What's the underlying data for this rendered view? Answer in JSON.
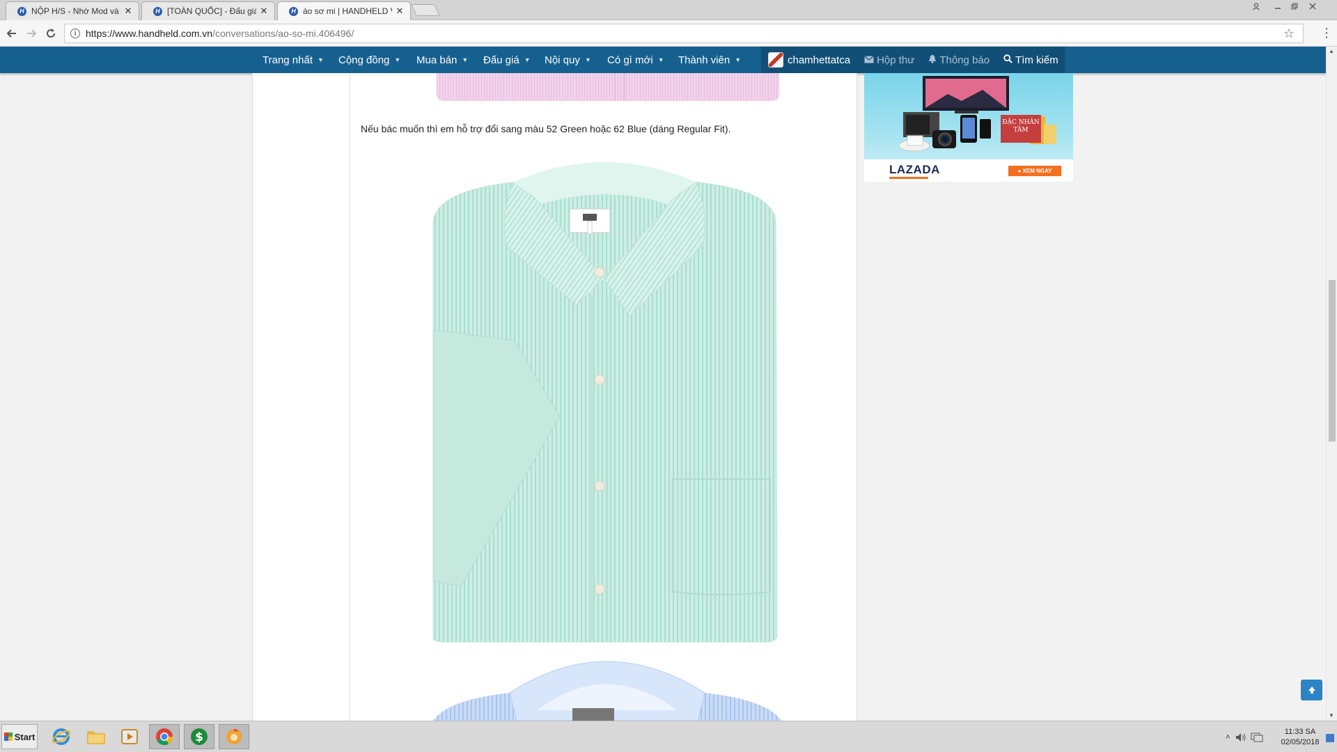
{
  "browser": {
    "tabs": [
      {
        "title": "NỘP H/S - Nhờ Mod và các",
        "active": false
      },
      {
        "title": "[TOÀN QUỐC] - Đấu giá ác",
        "active": false
      },
      {
        "title": "áo sơ mi | HANDHELD VIE",
        "active": true
      }
    ],
    "url_domain": "https://www.handheld.com.vn",
    "url_path": "/conversations/ao-so-mi.406496/"
  },
  "site_nav": {
    "items": [
      {
        "label": "Trang nhất"
      },
      {
        "label": "Cộng đồng"
      },
      {
        "label": "Mua bán"
      },
      {
        "label": "Đấu giá"
      },
      {
        "label": "Nội quy"
      },
      {
        "label": "Có gì mới"
      },
      {
        "label": "Thành viên"
      }
    ],
    "username": "chamhettatca",
    "inbox_label": "Hộp thư",
    "alerts_label": "Thông báo",
    "search_label": "Tìm kiếm"
  },
  "post": {
    "text": "Nếu bác muốn thì em hỗ trợ đổi sang màu 52 Green hoặc 62 Blue (dáng Regular Fit)."
  },
  "ad": {
    "brand": "LAZADA",
    "cta": "● XEM NGAY",
    "promo": "ĐẶC NHÂN TÂM"
  },
  "taskbar": {
    "start_label": "Start",
    "time": "11:33 SA",
    "date": "02/05/2018"
  },
  "colors": {
    "nav_bg": "#16608f",
    "accent": "#2d84c4",
    "ad_orange": "#f36f21"
  }
}
